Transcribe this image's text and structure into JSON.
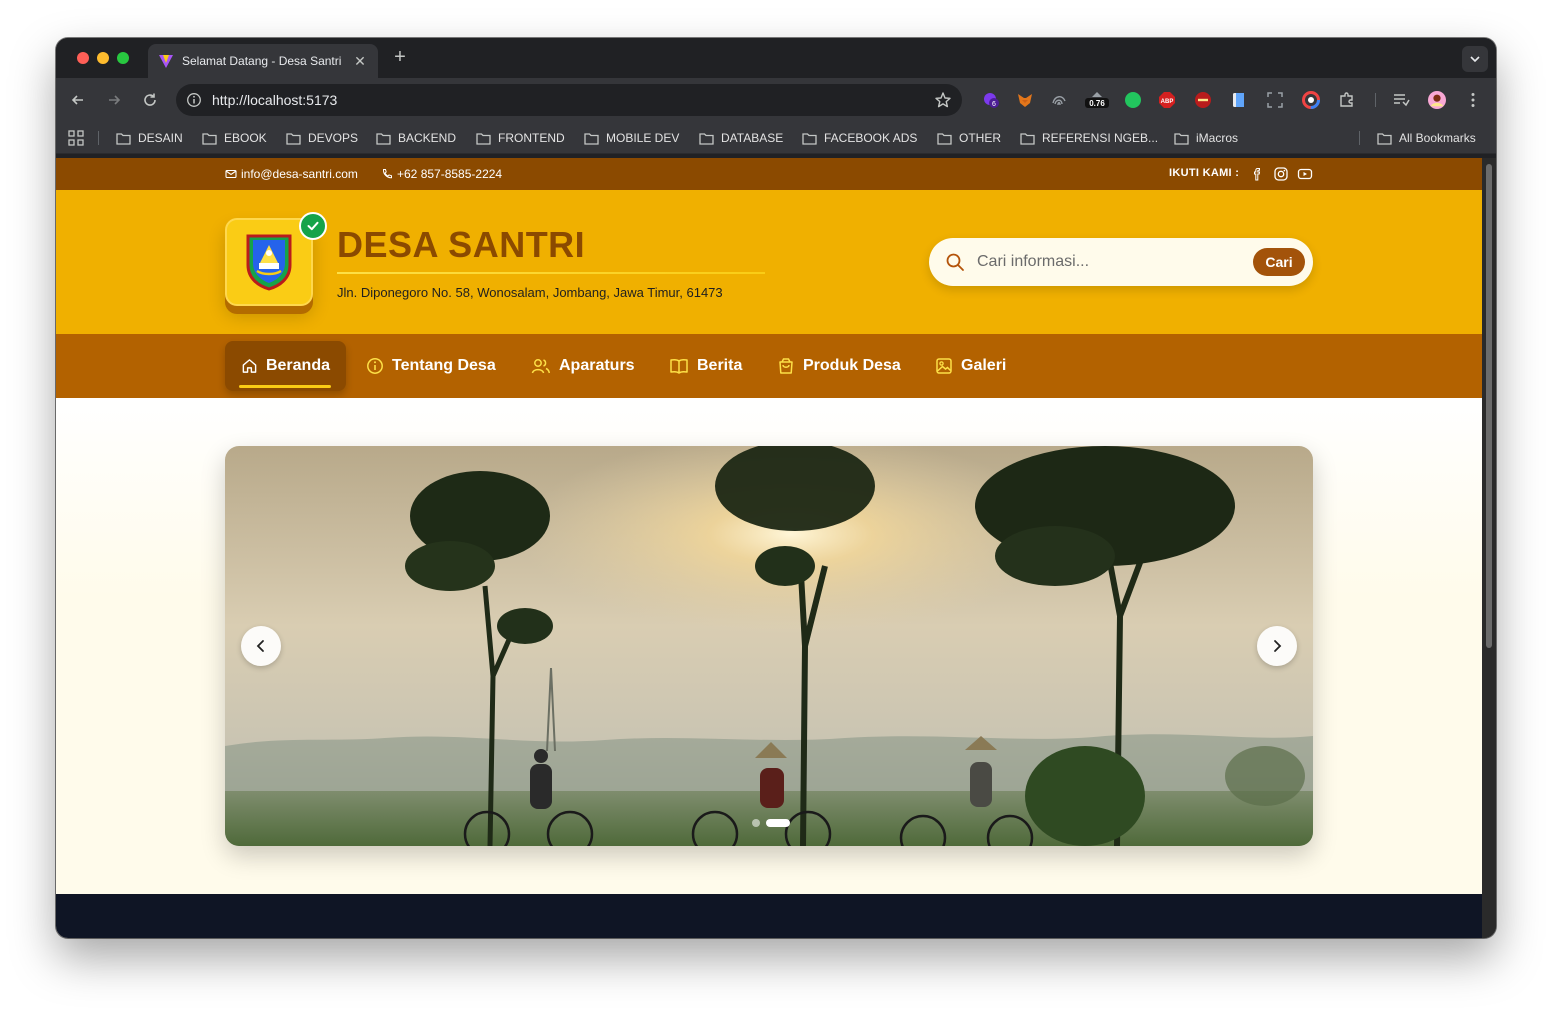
{
  "browser": {
    "tab_title": "Selamat Datang - Desa Santri",
    "url": "http://localhost:5173",
    "extension_badge_count": "6",
    "extension_badge_value": "0.76",
    "extension_abp_label": "ABP",
    "bookmarks": [
      "DESAIN",
      "EBOOK",
      "DEVOPS",
      "BACKEND",
      "FRONTEND",
      "MOBILE DEV",
      "DATABASE",
      "FACEBOOK ADS",
      "OTHER",
      "REFERENSI NGEB...",
      "iMacros"
    ],
    "all_bookmarks": "All Bookmarks"
  },
  "topbar": {
    "email": "info@desa-santri.com",
    "phone": "+62 857-8585-2224",
    "follow_label": "IKUTI KAMI :"
  },
  "header": {
    "title": "DESA SANTRI",
    "address": "Jln. Diponegoro No. 58, Wonosalam, Jombang, Jawa Timur, 61473",
    "search_placeholder": "Cari informasi...",
    "search_button": "Cari"
  },
  "nav": {
    "items": [
      {
        "label": "Beranda",
        "icon": "home-icon",
        "active": true
      },
      {
        "label": "Tentang Desa",
        "icon": "info-icon",
        "active": false
      },
      {
        "label": "Aparaturs",
        "icon": "users-icon",
        "active": false
      },
      {
        "label": "Berita",
        "icon": "book-open-icon",
        "active": false
      },
      {
        "label": "Produk Desa",
        "icon": "shopping-bag-icon",
        "active": false
      },
      {
        "label": "Galeri",
        "icon": "image-icon",
        "active": false
      }
    ]
  },
  "slider": {
    "slide_count": 2,
    "active_slide": 2
  },
  "colors": {
    "topbar": "#8b4a00",
    "header": "#f0b000",
    "navbar": "#b36200",
    "title": "#8b4a00",
    "accent": "#facc15",
    "verified": "#16a34a",
    "footer": "#0f1525"
  }
}
